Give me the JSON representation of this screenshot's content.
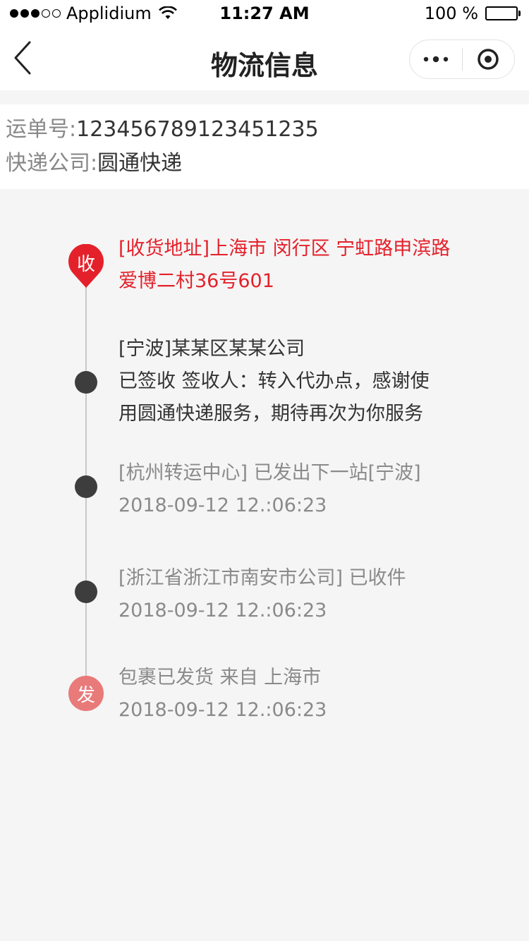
{
  "status_bar": {
    "carrier": "Applidium",
    "time": "11:27 AM",
    "battery": "100 %"
  },
  "nav": {
    "title": "物流信息"
  },
  "shipment": {
    "tracking_label": "运单号:",
    "tracking_number": "123456789123451235",
    "company_label": "快递公司:",
    "company_name": "圆通快递"
  },
  "timeline": {
    "receive_badge": "收",
    "send_badge": "发",
    "address_line1": "[收货地址]上海市 闵行区 宁虹路申滨路",
    "address_line2": "爱博二村36号601",
    "events": [
      {
        "line1": "[宁波]某某区某某公司",
        "line2": "已签收 签收人：转入代办点，感谢使",
        "line3": "用圆通快递服务，期待再次为你服务"
      },
      {
        "line1": "[杭州转运中心]  已发出下一站[宁波]",
        "line2": "2018-09-12  12.:06:23"
      },
      {
        "line1": "[浙江省浙江市南安市公司] 已收件",
        "line2": "2018-09-12  12.:06:23"
      },
      {
        "line1": "包裹已发货 来自 上海市",
        "line2": "2018-09-12  12.:06:23"
      }
    ]
  },
  "colors": {
    "accent_red": "#e4212b",
    "send_badge": "#e97a7a",
    "timeline_dot": "#3d3d3d"
  }
}
